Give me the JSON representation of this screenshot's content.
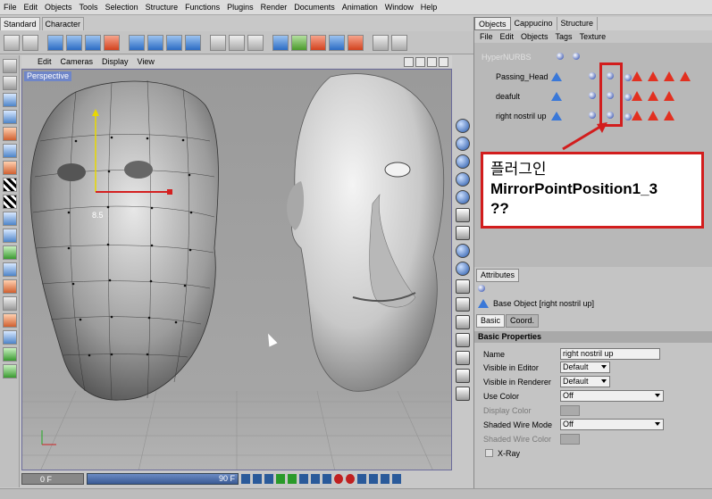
{
  "menubar": [
    "File",
    "Edit",
    "Objects",
    "Tools",
    "Selection",
    "Structure",
    "Functions",
    "Plugins",
    "Render",
    "Documents",
    "Animation",
    "Window",
    "Help"
  ],
  "layout_tabs": [
    "Standard",
    "Character"
  ],
  "viewport": {
    "menu": [
      "Edit",
      "Cameras",
      "Display",
      "View"
    ],
    "label": "Perspective",
    "distance_readout": "8.5"
  },
  "timeline": {
    "start": "0 F",
    "end": "90 F"
  },
  "object_manager": {
    "tabs": [
      "Objects",
      "Cappucino",
      "Structure"
    ],
    "menu": [
      "File",
      "Edit",
      "Objects",
      "Tags",
      "Texture"
    ],
    "objects": [
      {
        "name": "HyperNURBS"
      },
      {
        "name": "Passing_Head"
      },
      {
        "name": "deafult"
      },
      {
        "name": "right nostril up"
      }
    ]
  },
  "callout": {
    "line1": "플러그인",
    "line2": "MirrorPointPosition1_3",
    "line3": "??",
    "border_color": "#d21d1d"
  },
  "attributes": {
    "tab": "Attributes",
    "title": "Base Object [right nostril up]",
    "subtabs": [
      "Basic",
      "Coord."
    ],
    "section": "Basic Properties",
    "props": [
      {
        "label": "Name",
        "value": "right nostril up"
      },
      {
        "label": "Visible in Editor",
        "value": "Default"
      },
      {
        "label": "Visible in Renderer",
        "value": "Default"
      },
      {
        "label": "Use Color",
        "value": "Off"
      },
      {
        "label": "Display Color",
        "value": ""
      },
      {
        "label": "Shaded Wire Mode",
        "value": "Off"
      },
      {
        "label": "Shaded Wire Color",
        "value": ""
      },
      {
        "label": "X-Ray",
        "value": ""
      }
    ]
  },
  "colors": {
    "accent": "#6f86c8",
    "highlight": "#d21d1d"
  }
}
